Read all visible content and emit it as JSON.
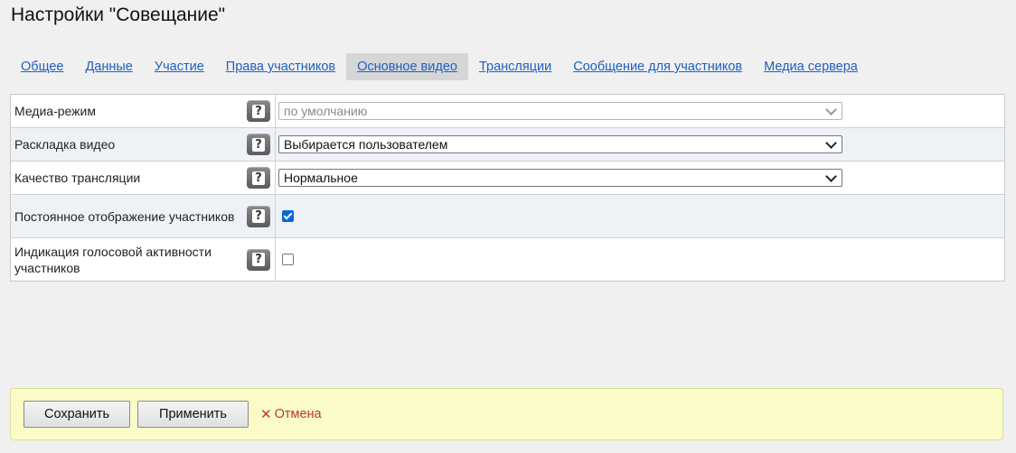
{
  "page": {
    "title": "Настройки \"Совещание\""
  },
  "tabs": [
    {
      "label": "Общее",
      "active": false
    },
    {
      "label": "Данные",
      "active": false
    },
    {
      "label": "Участие",
      "active": false
    },
    {
      "label": "Права участников",
      "active": false
    },
    {
      "label": "Основное видео",
      "active": true
    },
    {
      "label": "Трансляции",
      "active": false
    },
    {
      "label": "Сообщение для участников",
      "active": false
    },
    {
      "label": "Медиа сервера",
      "active": false
    }
  ],
  "settings": {
    "media_mode": {
      "label": "Медиа-режим",
      "value": "по умолчанию",
      "disabled": true
    },
    "video_layout": {
      "label": "Раскладка видео",
      "value": "Выбирается пользователем"
    },
    "stream_quality": {
      "label": "Качество трансляции",
      "value": "Нормальное"
    },
    "permanent_display": {
      "label": "Постоянное отображение участников",
      "checked": true
    },
    "voice_activity": {
      "label": "Индикация голосовой активности участников",
      "checked": false
    }
  },
  "help": {
    "icon_glyph": "?"
  },
  "footer": {
    "save_label": "Сохранить",
    "apply_label": "Применить",
    "cancel_icon": "✕",
    "cancel_label": "Отмена"
  },
  "colors": {
    "link": "#1f5fbf",
    "active_tab_bg": "#d6d6d6",
    "footer_bg": "#fbfbc8",
    "cancel": "#c0392b",
    "checkbox_checked": "#0b67d6"
  }
}
